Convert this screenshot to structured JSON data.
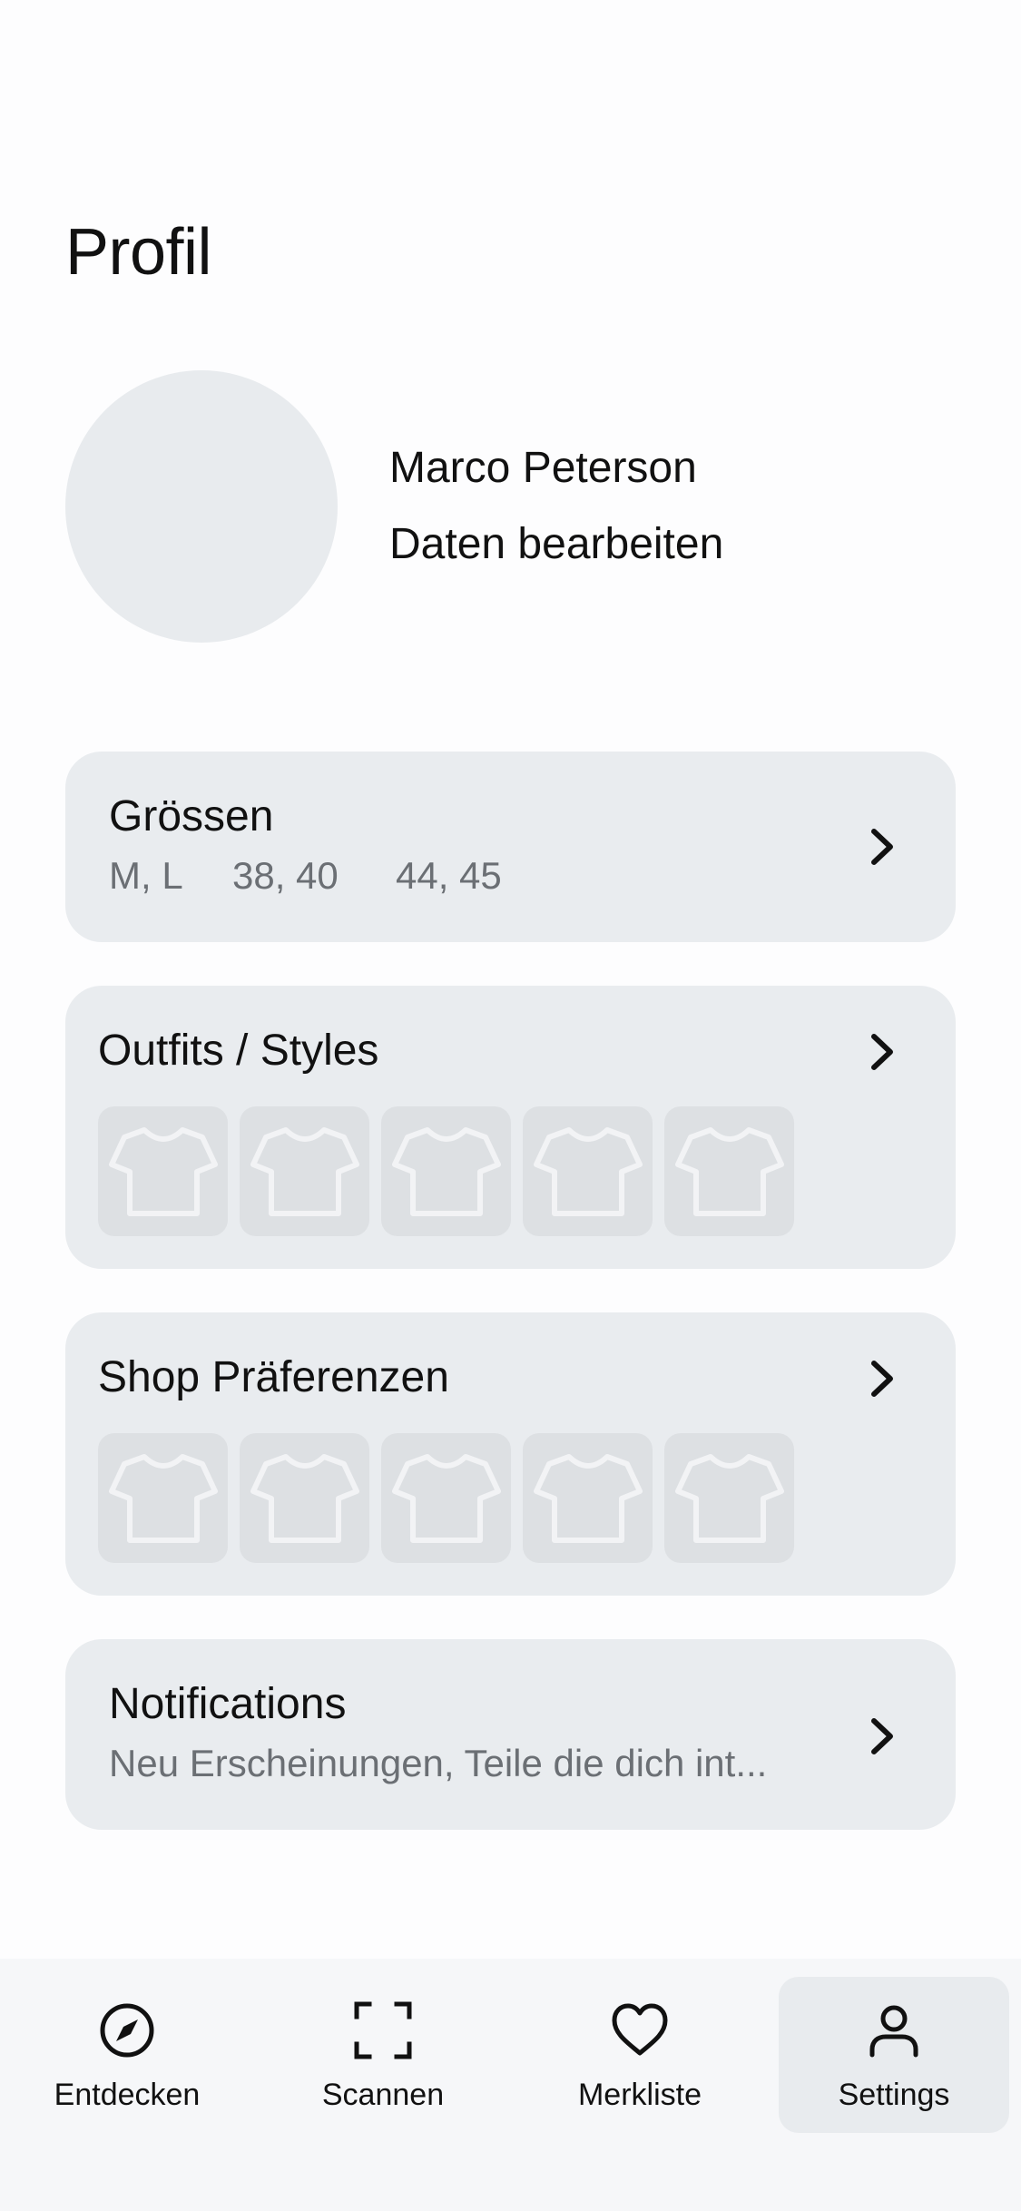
{
  "page": {
    "title": "Profil"
  },
  "profile": {
    "name": "Marco Peterson",
    "edit_link": "Daten bearbeiten"
  },
  "cards": {
    "sizes": {
      "title": "Grössen",
      "values": [
        "M, L",
        "38, 40",
        "44, 45"
      ]
    },
    "outfits": {
      "title": "Outfits / Styles",
      "thumbnail_icon": "tshirt-icon",
      "thumbnail_count": 5
    },
    "shops": {
      "title": "Shop Präferenzen",
      "thumbnail_icon": "tshirt-icon",
      "thumbnail_count": 5
    },
    "notifications": {
      "title": "Notifications",
      "subtitle": "Neu Erscheinungen, Teile die dich int..."
    }
  },
  "nav": {
    "active": "Settings",
    "items": [
      {
        "label": "Entdecken",
        "icon": "compass-icon"
      },
      {
        "label": "Scannen",
        "icon": "scan-frame-icon"
      },
      {
        "label": "Merkliste",
        "icon": "heart-icon"
      },
      {
        "label": "Settings",
        "icon": "person-icon"
      }
    ]
  },
  "colors": {
    "background": "#fdfdfe",
    "card": "#e9ecef",
    "thumbnail": "#dde0e3",
    "muted_text": "#6b6f74",
    "nav_background": "#f6f7f9",
    "nav_active": "#e8ebee"
  }
}
